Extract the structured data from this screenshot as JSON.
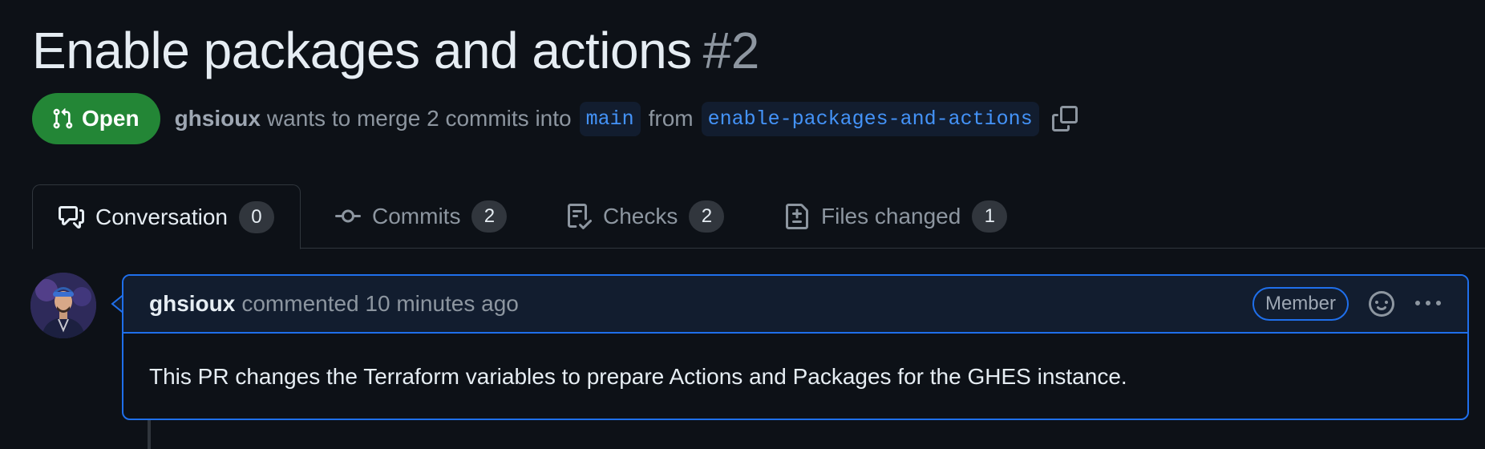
{
  "pr": {
    "title": "Enable packages and actions",
    "number": "#2",
    "state": "Open",
    "author": "ghsioux",
    "merge_text": "wants to merge 2 commits into",
    "base_branch": "main",
    "from_text": "from",
    "head_branch": "enable-packages-and-actions"
  },
  "tabs": [
    {
      "label": "Conversation",
      "count": "0",
      "icon": "comment-discussion-icon"
    },
    {
      "label": "Commits",
      "count": "2",
      "icon": "git-commit-icon"
    },
    {
      "label": "Checks",
      "count": "2",
      "icon": "checklist-icon"
    },
    {
      "label": "Files changed",
      "count": "1",
      "icon": "file-diff-icon"
    }
  ],
  "comment": {
    "author": "ghsioux",
    "meta": "commented 10 minutes ago",
    "role": "Member",
    "body": "This PR changes the Terraform variables to prepare Actions and Packages for the GHES instance."
  },
  "colors": {
    "background": "#0d1117",
    "open_green": "#238636",
    "accent_blue": "#1f6feb",
    "branch_text": "#4493f8"
  }
}
